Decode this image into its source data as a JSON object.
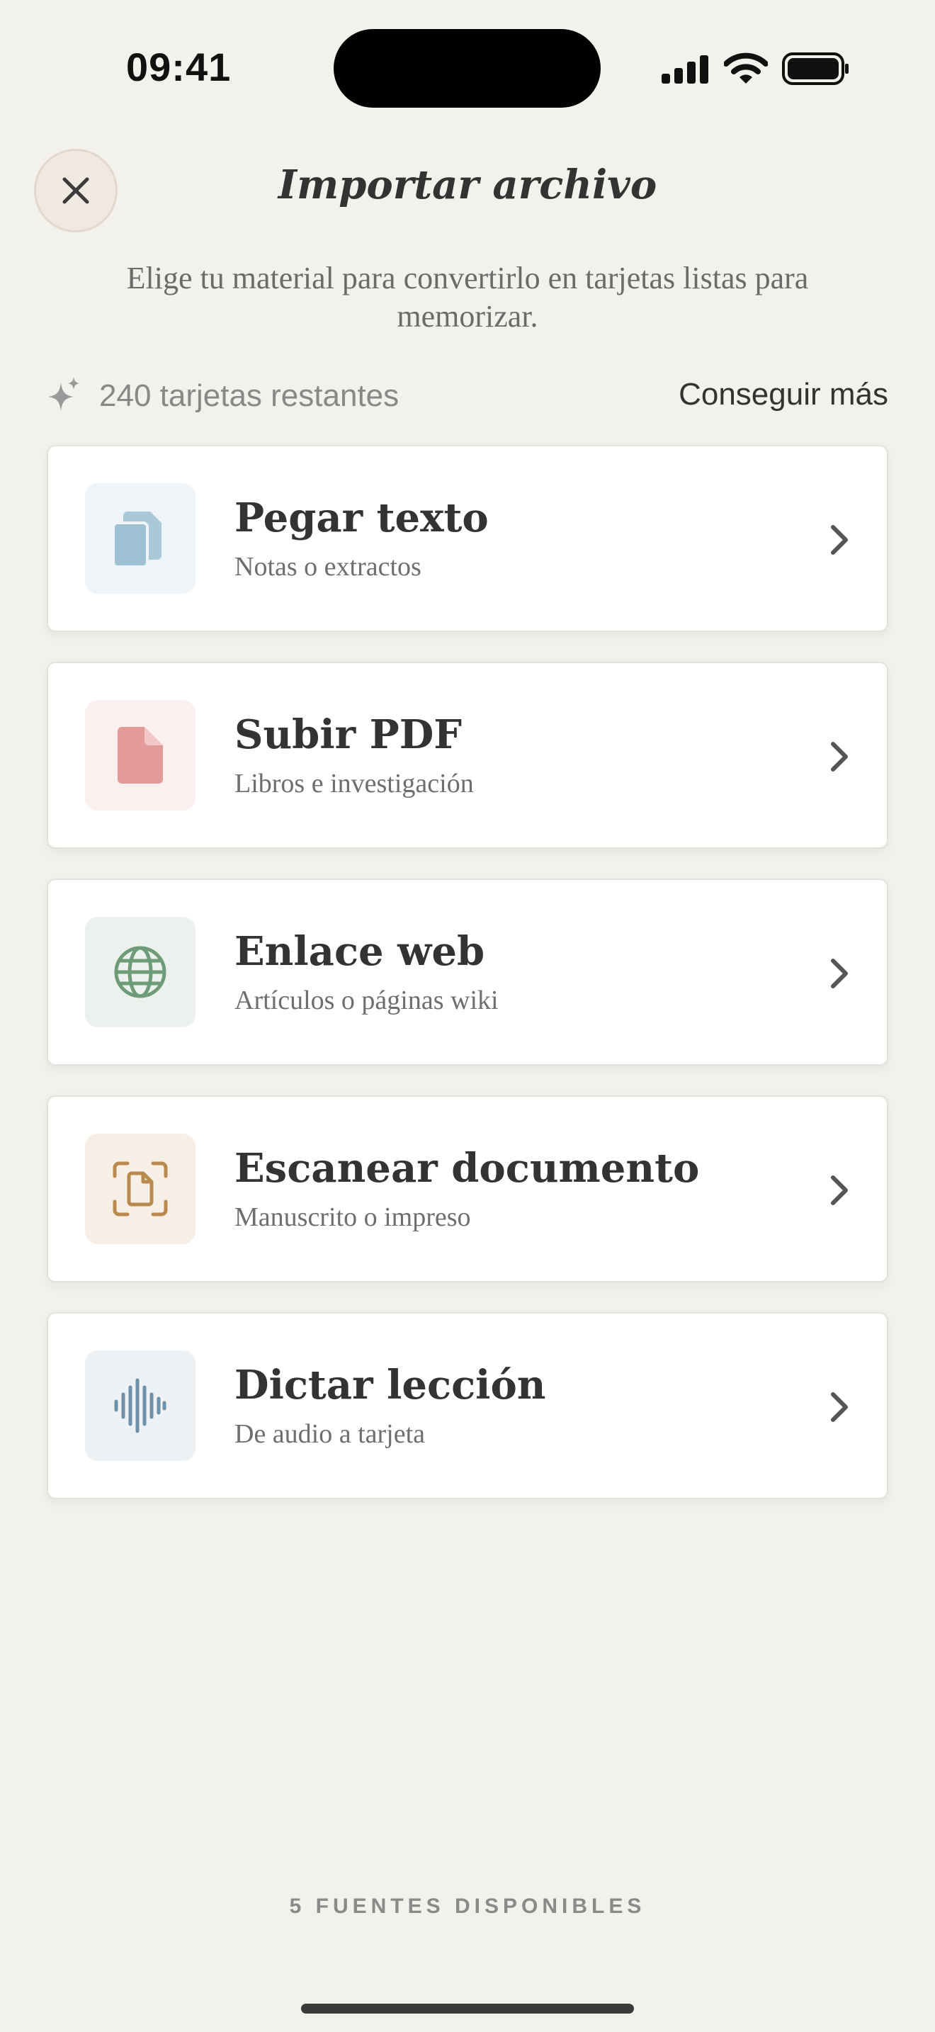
{
  "status_bar": {
    "time": "09:41"
  },
  "header": {
    "title": "Importar archivo",
    "close_icon": "close-icon"
  },
  "subtitle": "Elige tu material para convertirlo en tarjetas listas para memorizar.",
  "credits": {
    "icon": "sparkle-icon",
    "text": "240 tarjetas restantes",
    "action_label": "Conseguir más"
  },
  "sources": [
    {
      "title": "Pegar texto",
      "subtitle": "Notas o extractos",
      "icon": "clipboard-icon",
      "icon_color": "#9dc0d3",
      "icon_bg": "#eef4f8"
    },
    {
      "title": "Subir PDF",
      "subtitle": "Libros e investigación",
      "icon": "document-icon",
      "icon_color": "#e29a9a",
      "icon_bg": "#fbf0f0"
    },
    {
      "title": "Enlace web",
      "subtitle": "Artículos o páginas wiki",
      "icon": "globe-icon",
      "icon_color": "#6f9c78",
      "icon_bg": "#edf1ed"
    },
    {
      "title": "Escanear documento",
      "subtitle": "Manuscrito o impreso",
      "icon": "scan-document-icon",
      "icon_color": "#b88a4e",
      "icon_bg": "#f7efe6"
    },
    {
      "title": "Dictar lección",
      "subtitle": "De audio a tarjeta",
      "icon": "waveform-icon",
      "icon_color": "#6e90a8",
      "icon_bg": "#edf1f4"
    }
  ],
  "footer": {
    "label": "5 FUENTES DISPONIBLES"
  }
}
